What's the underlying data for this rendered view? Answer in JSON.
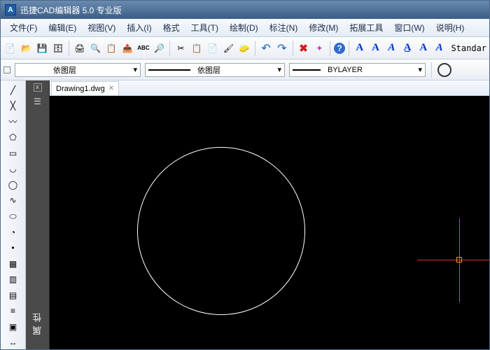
{
  "app": {
    "title": "迅捷CAD编辑器 5.0 专业版"
  },
  "menu": {
    "file": "文件(F)",
    "edit": "编辑(E)",
    "view": "视图(V)",
    "insert": "插入(I)",
    "format": "格式",
    "tools": "工具(T)",
    "draw": "绘制(D)",
    "dimension": "标注(N)",
    "modify": "修改(M)",
    "ext": "拓展工具",
    "window": "窗口(W)",
    "help": "说明(H)"
  },
  "toolbar": {
    "std": {
      "style_label": "Standar"
    }
  },
  "layerbar": {
    "layer_label": "依图层",
    "linetype_label": "依图层",
    "lineweight_label": "BYLAYER"
  },
  "doc": {
    "tab_name": "Drawing1.dwg",
    "close_glyph": "✕"
  },
  "prop_panel": {
    "title": "属性",
    "close": "x"
  },
  "icons": {
    "new": "📄",
    "open": "📂",
    "save": "💾",
    "saveall": "🗄",
    "print": "🖨",
    "preview": "🔍",
    "plot": "📋",
    "publish": "📤",
    "spell": "ABC",
    "find": "🔎",
    "cut": "✂",
    "copy": "📋",
    "paste": "📄",
    "match": "🖌",
    "erase": "🧽",
    "undo": "↶",
    "redo": "↷",
    "cancel": "✖",
    "purge": "✦",
    "help": "?",
    "line": "╱",
    "xline": "╳",
    "pline": "〰",
    "polygon": "⬠",
    "rect": "▭",
    "arc": "◡",
    "circle": "◯",
    "spline": "∿",
    "ellipse": "⬭",
    "earc": "◔",
    "point": "•",
    "hatch": "▦",
    "region": "▥",
    "table": "▤",
    "mtext": "≡",
    "block": "▣",
    "dim": "↔",
    "panel": "☰"
  },
  "colors": {
    "accent": "#1e5fa8"
  }
}
